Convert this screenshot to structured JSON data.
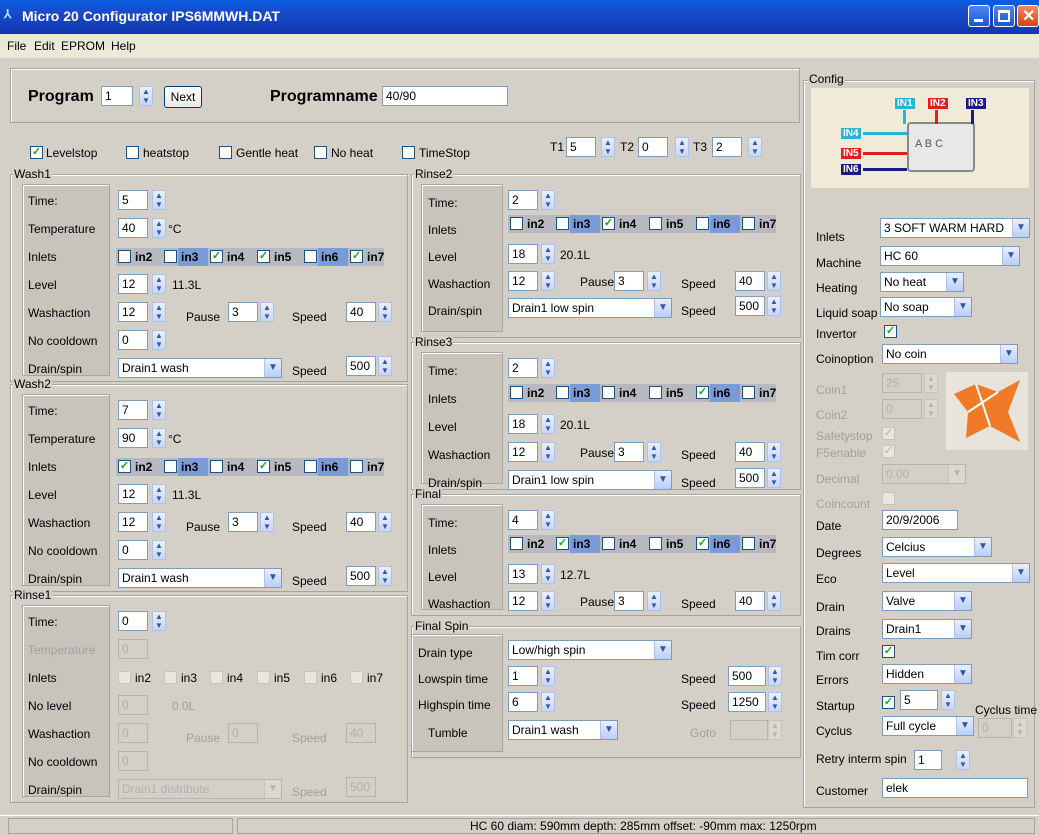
{
  "window": {
    "title": "Micro 20 Configurator IPS6MMWH.DAT"
  },
  "menu": [
    "File",
    "Edit",
    "EPROM",
    "Help"
  ],
  "program": {
    "label": "Program",
    "value": "1",
    "next": "Next",
    "name_label": "Programname",
    "name_value": "40/90"
  },
  "flags": {
    "levelstop": "Levelstop",
    "heatstop": "heatstop",
    "gentle": "Gentle heat",
    "noheat": "No heat",
    "timestop": "TimeStop",
    "t1": "T1",
    "t1v": "5",
    "t2": "T2",
    "t2v": "0",
    "t3": "T3",
    "t3v": "2"
  },
  "labels": {
    "time": "Time:",
    "temp": "Temperature",
    "inlets": "Inlets",
    "level": "Level",
    "nolevel": "No level",
    "wash": "Washaction",
    "nocool": "No cooldown",
    "drain": "Drain/spin",
    "pause": "Pause",
    "speed": "Speed",
    "degc": "°C",
    "in2": "in2",
    "in3": "in3",
    "in4": "in4",
    "in5": "in5",
    "in6": "in6",
    "in7": "in7"
  },
  "wash1": {
    "title": "Wash1",
    "time": "5",
    "temp": "40",
    "level": "12",
    "liters": "11.3L",
    "wash": "12",
    "pause": "3",
    "speed": "40",
    "nocool": "0",
    "drain": "Drain1 wash",
    "dspeed": "500"
  },
  "wash2": {
    "title": "Wash2",
    "time": "7",
    "temp": "90",
    "level": "12",
    "liters": "11.3L",
    "wash": "12",
    "pause": "3",
    "speed": "40",
    "nocool": "0",
    "drain": "Drain1 wash",
    "dspeed": "500"
  },
  "rinse1": {
    "title": "Rinse1",
    "time": "0",
    "temp": "0",
    "level": "0",
    "liters": "0.0L",
    "wash": "0",
    "pause": "0",
    "speed": "40",
    "nocool": "0",
    "drain": "Drain1 distribute",
    "dspeed": "500"
  },
  "rinse2": {
    "title": "Rinse2",
    "time": "2",
    "level": "18",
    "liters": "20.1L",
    "wash": "12",
    "pause": "3",
    "speed": "40",
    "drain": "Drain1 low spin",
    "dspeed": "500"
  },
  "rinse3": {
    "title": "Rinse3",
    "time": "2",
    "level": "18",
    "liters": "20.1L",
    "wash": "12",
    "pause": "3",
    "speed": "40",
    "drain": "Drain1 low spin",
    "dspeed": "500"
  },
  "final": {
    "title": "Final",
    "time": "4",
    "level": "13",
    "liters": "12.7L",
    "wash": "12",
    "pause": "3",
    "speed": "40"
  },
  "finalspin": {
    "title": "Final Spin",
    "drain_type_l": "Drain type",
    "drain_type": "Low/high spin",
    "low_l": "Lowspin time",
    "low": "1",
    "low_speed": "500",
    "high_l": "Highspin time",
    "high": "6",
    "high_speed": "1250",
    "tumble_l": "Tumble",
    "tumble": "Drain1 wash",
    "goto": "Goto"
  },
  "config": {
    "title": "Config",
    "in1": "IN1",
    "in2": "IN2",
    "in3": "IN3",
    "in4": "IN4",
    "in5": "IN5",
    "in6": "IN6",
    "abc": "A B C",
    "inlets_l": "Inlets",
    "inlets": "3 SOFT WARM HARD",
    "machine_l": "Machine",
    "machine": "HC 60",
    "heating_l": "Heating",
    "heating": "No heat",
    "soap_l": "Liquid soap",
    "soap": "No soap",
    "inv_l": "Invertor",
    "coin_l": "Coinoption",
    "coin": "No coin",
    "coin1_l": "Coin1",
    "coin1": "25",
    "coin2_l": "Coin2",
    "coin2": "0",
    "safety_l": "Safetystop",
    "f5_l": "F5enable",
    "dec_l": "Decimal",
    "dec": "0.00",
    "coincount_l": "Coincount",
    "date_l": "Date",
    "date": "20/9/2006",
    "deg_l": "Degrees",
    "deg": "Celcius",
    "eco_l": "Eco",
    "eco": "Level",
    "drain_l": "Drain",
    "drain": "Valve",
    "drains_l": "Drains",
    "drains": "Drain1",
    "timcorr_l": "Tim corr",
    "errors_l": "Errors",
    "errors": "Hidden",
    "startup_l": "Startup",
    "startup": "5",
    "cyclus_l": "Cyclus",
    "cyclus": "Full cycle",
    "cyctime_l": "Cyclus time",
    "cyctime": "0",
    "retry_l": "Retry interm spin",
    "retry": "1",
    "cust_l": "Customer",
    "cust": "elek"
  },
  "status": "HC 60 diam: 590mm depth: 285mm offset: -90mm max: 1250rpm"
}
